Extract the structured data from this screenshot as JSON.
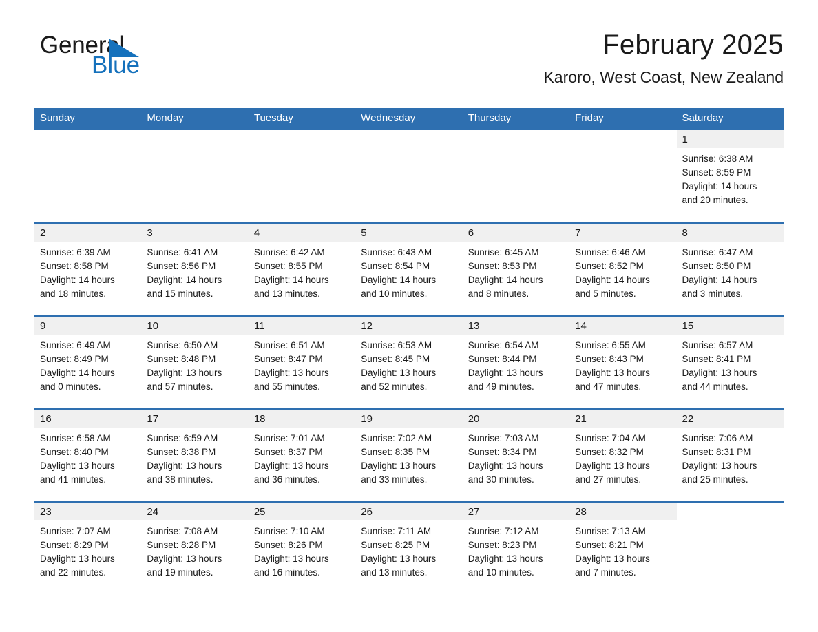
{
  "brand": {
    "name_part1": "General",
    "name_part2": "Blue",
    "triangle_color": "#1571bc",
    "accent_color": "#2e6fb0"
  },
  "header": {
    "title": "February 2025",
    "subtitle": "Karoro, West Coast, New Zealand"
  },
  "calendar": {
    "weekday_headers": [
      "Sunday",
      "Monday",
      "Tuesday",
      "Wednesday",
      "Thursday",
      "Friday",
      "Saturday"
    ],
    "labels": {
      "sunrise": "Sunrise:",
      "sunset": "Sunset:",
      "daylight": "Daylight:"
    },
    "weeks": [
      [
        {
          "day": "",
          "blank": true
        },
        {
          "day": "",
          "blank": true
        },
        {
          "day": "",
          "blank": true
        },
        {
          "day": "",
          "blank": true
        },
        {
          "day": "",
          "blank": true
        },
        {
          "day": "",
          "blank": true
        },
        {
          "day": "1",
          "sunrise": "Sunrise: 6:38 AM",
          "sunset": "Sunset: 8:59 PM",
          "daylight_l1": "Daylight: 14 hours",
          "daylight_l2": "and 20 minutes."
        }
      ],
      [
        {
          "day": "2",
          "sunrise": "Sunrise: 6:39 AM",
          "sunset": "Sunset: 8:58 PM",
          "daylight_l1": "Daylight: 14 hours",
          "daylight_l2": "and 18 minutes."
        },
        {
          "day": "3",
          "sunrise": "Sunrise: 6:41 AM",
          "sunset": "Sunset: 8:56 PM",
          "daylight_l1": "Daylight: 14 hours",
          "daylight_l2": "and 15 minutes."
        },
        {
          "day": "4",
          "sunrise": "Sunrise: 6:42 AM",
          "sunset": "Sunset: 8:55 PM",
          "daylight_l1": "Daylight: 14 hours",
          "daylight_l2": "and 13 minutes."
        },
        {
          "day": "5",
          "sunrise": "Sunrise: 6:43 AM",
          "sunset": "Sunset: 8:54 PM",
          "daylight_l1": "Daylight: 14 hours",
          "daylight_l2": "and 10 minutes."
        },
        {
          "day": "6",
          "sunrise": "Sunrise: 6:45 AM",
          "sunset": "Sunset: 8:53 PM",
          "daylight_l1": "Daylight: 14 hours",
          "daylight_l2": "and 8 minutes."
        },
        {
          "day": "7",
          "sunrise": "Sunrise: 6:46 AM",
          "sunset": "Sunset: 8:52 PM",
          "daylight_l1": "Daylight: 14 hours",
          "daylight_l2": "and 5 minutes."
        },
        {
          "day": "8",
          "sunrise": "Sunrise: 6:47 AM",
          "sunset": "Sunset: 8:50 PM",
          "daylight_l1": "Daylight: 14 hours",
          "daylight_l2": "and 3 minutes."
        }
      ],
      [
        {
          "day": "9",
          "sunrise": "Sunrise: 6:49 AM",
          "sunset": "Sunset: 8:49 PM",
          "daylight_l1": "Daylight: 14 hours",
          "daylight_l2": "and 0 minutes."
        },
        {
          "day": "10",
          "sunrise": "Sunrise: 6:50 AM",
          "sunset": "Sunset: 8:48 PM",
          "daylight_l1": "Daylight: 13 hours",
          "daylight_l2": "and 57 minutes."
        },
        {
          "day": "11",
          "sunrise": "Sunrise: 6:51 AM",
          "sunset": "Sunset: 8:47 PM",
          "daylight_l1": "Daylight: 13 hours",
          "daylight_l2": "and 55 minutes."
        },
        {
          "day": "12",
          "sunrise": "Sunrise: 6:53 AM",
          "sunset": "Sunset: 8:45 PM",
          "daylight_l1": "Daylight: 13 hours",
          "daylight_l2": "and 52 minutes."
        },
        {
          "day": "13",
          "sunrise": "Sunrise: 6:54 AM",
          "sunset": "Sunset: 8:44 PM",
          "daylight_l1": "Daylight: 13 hours",
          "daylight_l2": "and 49 minutes."
        },
        {
          "day": "14",
          "sunrise": "Sunrise: 6:55 AM",
          "sunset": "Sunset: 8:43 PM",
          "daylight_l1": "Daylight: 13 hours",
          "daylight_l2": "and 47 minutes."
        },
        {
          "day": "15",
          "sunrise": "Sunrise: 6:57 AM",
          "sunset": "Sunset: 8:41 PM",
          "daylight_l1": "Daylight: 13 hours",
          "daylight_l2": "and 44 minutes."
        }
      ],
      [
        {
          "day": "16",
          "sunrise": "Sunrise: 6:58 AM",
          "sunset": "Sunset: 8:40 PM",
          "daylight_l1": "Daylight: 13 hours",
          "daylight_l2": "and 41 minutes."
        },
        {
          "day": "17",
          "sunrise": "Sunrise: 6:59 AM",
          "sunset": "Sunset: 8:38 PM",
          "daylight_l1": "Daylight: 13 hours",
          "daylight_l2": "and 38 minutes."
        },
        {
          "day": "18",
          "sunrise": "Sunrise: 7:01 AM",
          "sunset": "Sunset: 8:37 PM",
          "daylight_l1": "Daylight: 13 hours",
          "daylight_l2": "and 36 minutes."
        },
        {
          "day": "19",
          "sunrise": "Sunrise: 7:02 AM",
          "sunset": "Sunset: 8:35 PM",
          "daylight_l1": "Daylight: 13 hours",
          "daylight_l2": "and 33 minutes."
        },
        {
          "day": "20",
          "sunrise": "Sunrise: 7:03 AM",
          "sunset": "Sunset: 8:34 PM",
          "daylight_l1": "Daylight: 13 hours",
          "daylight_l2": "and 30 minutes."
        },
        {
          "day": "21",
          "sunrise": "Sunrise: 7:04 AM",
          "sunset": "Sunset: 8:32 PM",
          "daylight_l1": "Daylight: 13 hours",
          "daylight_l2": "and 27 minutes."
        },
        {
          "day": "22",
          "sunrise": "Sunrise: 7:06 AM",
          "sunset": "Sunset: 8:31 PM",
          "daylight_l1": "Daylight: 13 hours",
          "daylight_l2": "and 25 minutes."
        }
      ],
      [
        {
          "day": "23",
          "sunrise": "Sunrise: 7:07 AM",
          "sunset": "Sunset: 8:29 PM",
          "daylight_l1": "Daylight: 13 hours",
          "daylight_l2": "and 22 minutes."
        },
        {
          "day": "24",
          "sunrise": "Sunrise: 7:08 AM",
          "sunset": "Sunset: 8:28 PM",
          "daylight_l1": "Daylight: 13 hours",
          "daylight_l2": "and 19 minutes."
        },
        {
          "day": "25",
          "sunrise": "Sunrise: 7:10 AM",
          "sunset": "Sunset: 8:26 PM",
          "daylight_l1": "Daylight: 13 hours",
          "daylight_l2": "and 16 minutes."
        },
        {
          "day": "26",
          "sunrise": "Sunrise: 7:11 AM",
          "sunset": "Sunset: 8:25 PM",
          "daylight_l1": "Daylight: 13 hours",
          "daylight_l2": "and 13 minutes."
        },
        {
          "day": "27",
          "sunrise": "Sunrise: 7:12 AM",
          "sunset": "Sunset: 8:23 PM",
          "daylight_l1": "Daylight: 13 hours",
          "daylight_l2": "and 10 minutes."
        },
        {
          "day": "28",
          "sunrise": "Sunrise: 7:13 AM",
          "sunset": "Sunset: 8:21 PM",
          "daylight_l1": "Daylight: 13 hours",
          "daylight_l2": "and 7 minutes."
        },
        {
          "day": "",
          "blank": true,
          "trailing": true
        }
      ]
    ]
  }
}
